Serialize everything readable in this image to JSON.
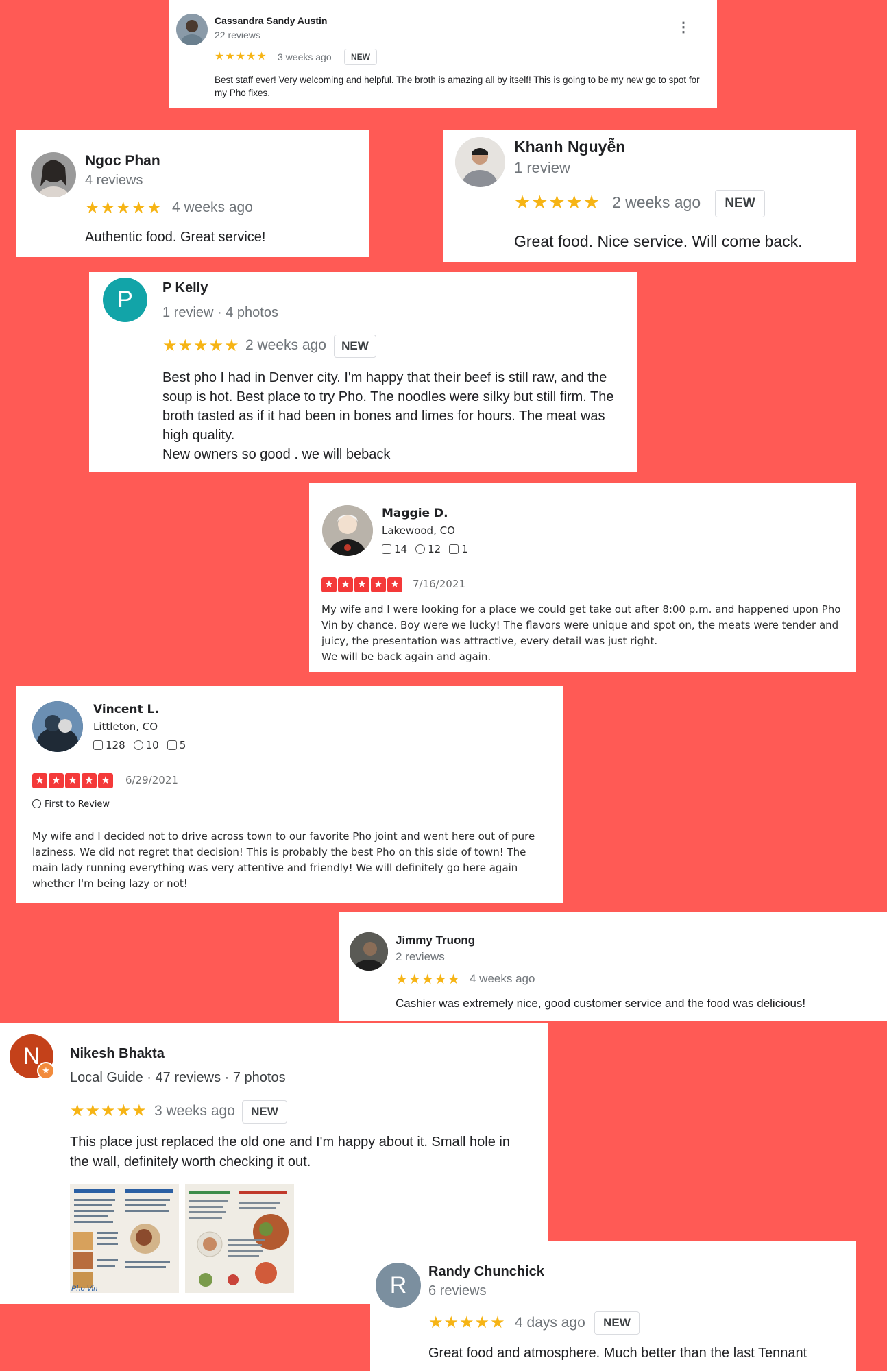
{
  "reviews": {
    "cassandra": {
      "name": "Cassandra Sandy Austin",
      "meta": "22 reviews",
      "stars": "★★★★★",
      "ago": "3 weeks ago",
      "badge": "NEW",
      "text": "Best staff ever! Very welcoming and helpful. The broth is amazing all by itself! This is going to be my new go to spot for my Pho fixes.",
      "menu_icon": "more-vert-icon"
    },
    "ngoc": {
      "name": "Ngoc Phan",
      "meta": "4 reviews",
      "stars": "★★★★★",
      "ago": "4 weeks ago",
      "text": "Authentic food. Great service!"
    },
    "khanh": {
      "name": "Khanh Nguyễn",
      "meta": "1 review",
      "stars": "★★★★★",
      "ago": "2 weeks ago",
      "badge": "NEW",
      "text": "Great food. Nice service. Will come back."
    },
    "pkelly": {
      "name": "P Kelly",
      "initial": "P",
      "meta": "1 review · 4 photos",
      "stars": "★★★★★",
      "ago": "2 weeks ago",
      "badge": "NEW",
      "text_lines": [
        "Best pho I had in Denver city. I'm happy that their beef is still raw, and the",
        "soup is hot. Best place to try Pho. The noodles were silky but still firm. The",
        "broth tasted as if it had been in bones and limes for hours. The meat was",
        "high quality.",
        "New owners so good . we will beback"
      ]
    },
    "maggie": {
      "name": "Maggie D.",
      "location": "Lakewood, CO",
      "friends": "14",
      "reviews": "12",
      "photos": "1",
      "date": "7/16/2021",
      "text_lines": [
        "My wife and I were looking for a place we could get take out after 8:00 p.m. and happened upon Pho",
        "Vin by chance. Boy were we lucky! The flavors were unique and spot on, the meats were tender and",
        "juicy, the presentation was attractive, every detail was just right.",
        "We will be back again and again."
      ]
    },
    "vincent": {
      "name": "Vincent L.",
      "location": "Littleton, CO",
      "friends": "128",
      "reviews": "10",
      "photos": "5",
      "date": "6/29/2021",
      "badge": "First to Review",
      "text_lines": [
        "My wife and I decided not to drive across town to our favorite Pho joint and went here out of pure",
        "laziness. We did not regret that decision! This is probably the best Pho on this side of town! The",
        "main lady running everything was very attentive and friendly! We will definitely go here again",
        "whether I'm being lazy or not!"
      ]
    },
    "jimmy": {
      "name": "Jimmy Truong",
      "meta": "2 reviews",
      "stars": "★★★★★",
      "ago": "4 weeks ago",
      "text": "Cashier was extremely nice, good customer service and the food was delicious!"
    },
    "nikesh": {
      "name": "Nikesh Bhakta",
      "initial": "N",
      "meta": "Local Guide · 47 reviews · 7 photos",
      "stars": "★★★★★",
      "ago": "3 weeks ago",
      "badge": "NEW",
      "text_lines": [
        "This place just replaced the old one and I'm happy about it. Small hole in",
        "the wall, definitely worth checking it out."
      ],
      "photo_caption": "Pho Vin"
    },
    "randy": {
      "name": "Randy Chunchick",
      "initial": "R",
      "meta": "6 reviews",
      "stars": "★★★★★",
      "ago": "4 days ago",
      "badge": "NEW",
      "text": "Great food and atmosphere. Much better than the last Tennant"
    }
  },
  "colors": {
    "background": "#ff5a55",
    "google_star": "#f6b415",
    "yelp_star": "#f43939",
    "pkelly_avatar": "#12a4a8",
    "nikesh_avatar": "#c4411a",
    "randy_avatar": "#7b8f9f"
  }
}
